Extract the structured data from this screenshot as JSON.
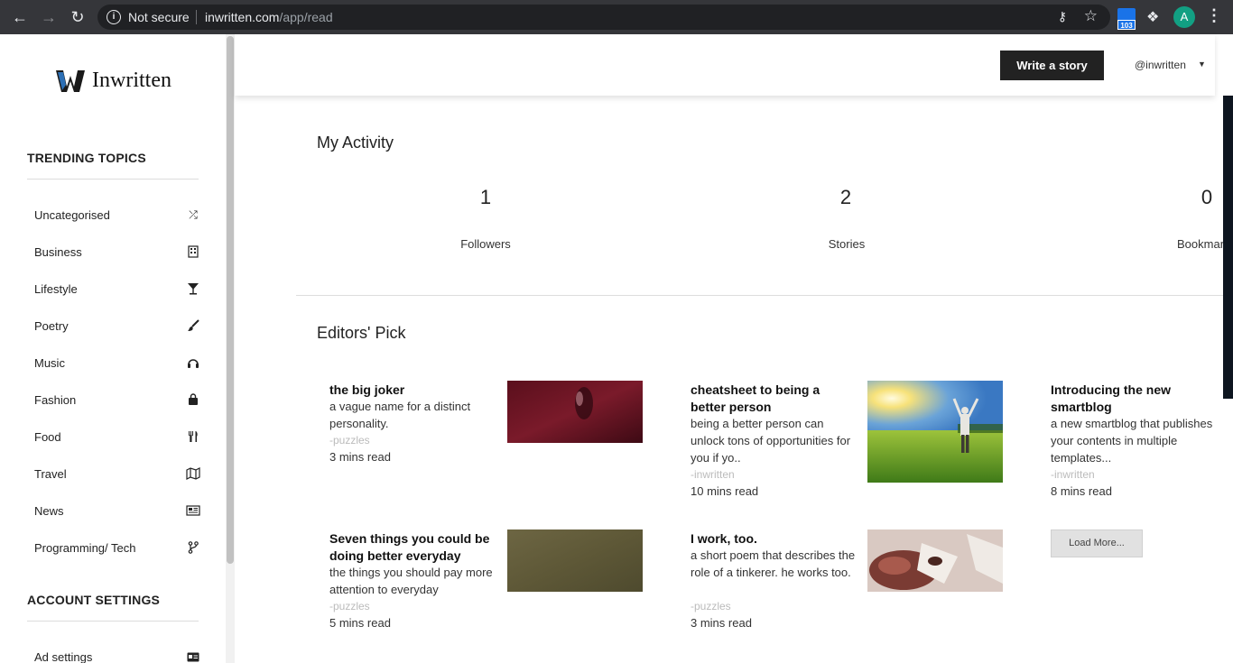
{
  "browser": {
    "security_label": "Not secure",
    "url_host": "inwritten.com",
    "url_path": "/app/read",
    "extension_badge": "103",
    "profile_initial": "A"
  },
  "sidebar": {
    "logo_text": "Inwritten",
    "trending_title": "TRENDING TOPICS",
    "topics": [
      {
        "label": "Uncategorised",
        "icon": "shuffle-icon"
      },
      {
        "label": "Business",
        "icon": "building-icon"
      },
      {
        "label": "Lifestyle",
        "icon": "cocktail-icon"
      },
      {
        "label": "Poetry",
        "icon": "brush-icon"
      },
      {
        "label": "Music",
        "icon": "headphones-icon"
      },
      {
        "label": "Fashion",
        "icon": "shopping-bag-icon"
      },
      {
        "label": "Food",
        "icon": "utensils-icon"
      },
      {
        "label": "Travel",
        "icon": "map-icon"
      },
      {
        "label": "News",
        "icon": "newspaper-icon"
      },
      {
        "label": "Programming/ Tech",
        "icon": "code-branch-icon"
      }
    ],
    "account_title": "ACCOUNT SETTINGS",
    "account_items": [
      {
        "label": "Ad settings",
        "icon": "id-card-icon"
      }
    ]
  },
  "header": {
    "write_button": "Write a story",
    "username": "@inwritten"
  },
  "activity": {
    "title": "My Activity",
    "stats": [
      {
        "value": "1",
        "label": "Followers"
      },
      {
        "value": "2",
        "label": "Stories"
      },
      {
        "value": "0",
        "label": "Bookmarks"
      }
    ]
  },
  "editors_pick": {
    "title": "Editors' Pick",
    "load_more": "Load More...",
    "stories": [
      {
        "title": "the big joker",
        "desc": "a vague name for a distinct personality.",
        "author": "-puzzles",
        "time": "3 mins read"
      },
      {
        "title": "cheatsheet to being a better person",
        "desc": "being a better person can unlock tons of opportunities for you if yo..",
        "author": "-inwritten",
        "time": "10 mins read"
      },
      {
        "title": "Introducing the new smartblog",
        "desc": "a new smartblog that publishes your contents in multiple templates...",
        "author": "-inwritten",
        "time": "8 mins read"
      },
      {
        "title": "Seven things you could be doing better everyday",
        "desc": "the things you should pay more attention to everyday",
        "author": "-puzzles",
        "time": "5 mins read"
      },
      {
        "title": "I work, too.",
        "desc": "a short poem that describes the role of a tinkerer. he works too.",
        "author": "-puzzles",
        "time": "3 mins read"
      }
    ]
  }
}
